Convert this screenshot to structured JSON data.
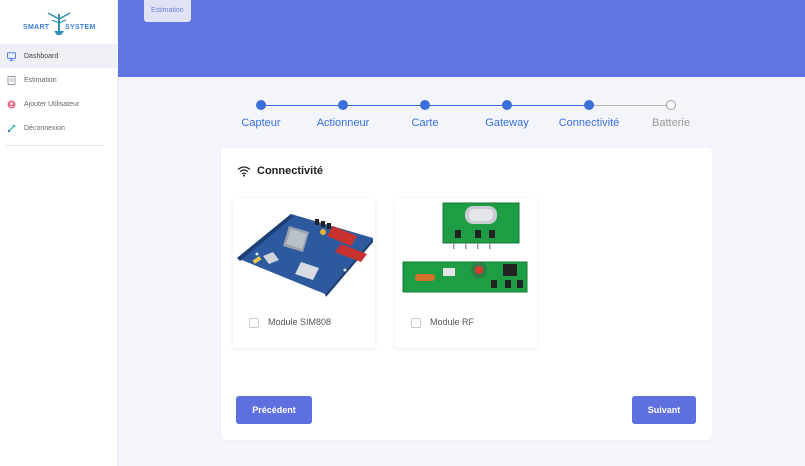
{
  "app": {
    "logo_left": "SMART",
    "logo_right": "SYSTEM"
  },
  "sidebar": {
    "items": [
      {
        "label": "Dashboard",
        "icon": "monitor-icon",
        "active": true
      },
      {
        "label": "Estimation",
        "icon": "document-icon",
        "active": false
      },
      {
        "label": "Ajouter Utilisateur",
        "icon": "user-icon",
        "active": false
      },
      {
        "label": "Déconnexion",
        "icon": "logout-icon",
        "active": false
      }
    ]
  },
  "header": {
    "breadcrumb": "Estimation"
  },
  "stepper": {
    "steps": [
      {
        "label": "Capteur",
        "done": true
      },
      {
        "label": "Actionneur",
        "done": true
      },
      {
        "label": "Carte",
        "done": true
      },
      {
        "label": "Gateway",
        "done": true
      },
      {
        "label": "Connectivité",
        "done": true
      },
      {
        "label": "Batterie",
        "done": false
      }
    ]
  },
  "card": {
    "title": "Connectivité",
    "title_icon": "wifi-icon",
    "options": [
      {
        "label": "Module SIM808",
        "checked": false,
        "image": "sim808-board-image"
      },
      {
        "label": "Module RF",
        "checked": false,
        "image": "rf-module-image"
      }
    ],
    "prev_label": "Précédent",
    "next_label": "Suivant"
  },
  "colors": {
    "accent": "#5e75e2",
    "step_done": "#3a6fdc",
    "step_todo": "#9a9a9a",
    "button": "#5e6fe0"
  }
}
